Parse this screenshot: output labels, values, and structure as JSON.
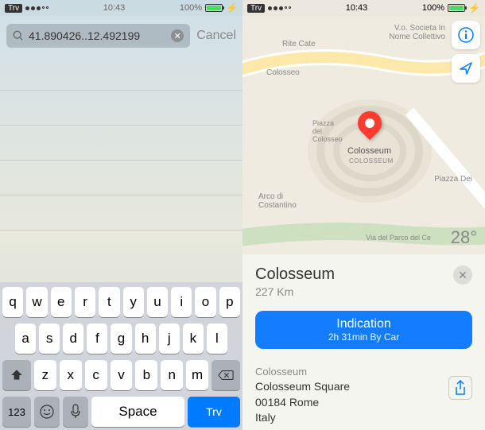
{
  "status": {
    "back_app": "Trv",
    "carrier_dots": 5,
    "time": "10:43",
    "battery_pct": "100%"
  },
  "left": {
    "search_value": "41.890426..12.492199",
    "cancel_label": "Cancel",
    "keyboard": {
      "row1": [
        "q",
        "w",
        "e",
        "r",
        "t",
        "y",
        "u",
        "i",
        "o",
        "p"
      ],
      "row2": [
        "a",
        "s",
        "d",
        "f",
        "g",
        "h",
        "j",
        "k",
        "l"
      ],
      "row3": [
        "z",
        "x",
        "c",
        "v",
        "b",
        "n",
        "m"
      ],
      "num_label": "123",
      "space_label": "Space",
      "search_label": "Trv"
    }
  },
  "right": {
    "map": {
      "labels": {
        "top1": "Rite Cate",
        "top2": "V.o. Societa In\nNome Collettivo",
        "colosseo": "Colosseo",
        "piazza": "Piazza\ndel\nColosseo",
        "arch": "Arco di\nCostantino",
        "piazza_del": "Piazza Dei",
        "via_parco": "Via del Parco del Ce",
        "colosseum_label": "Colosseum",
        "colosseum_sub": "COLOSSEUM"
      },
      "temperature": "28°"
    },
    "place": {
      "title": "Colosseum",
      "distance": "227 Km",
      "indication_label": "Indication",
      "indication_sub": "2h 31min By Car",
      "address_label": "Colosseum",
      "address_line1": "Colosseum Square",
      "address_line2": "00184 Rome",
      "address_line3": "Italy"
    }
  }
}
